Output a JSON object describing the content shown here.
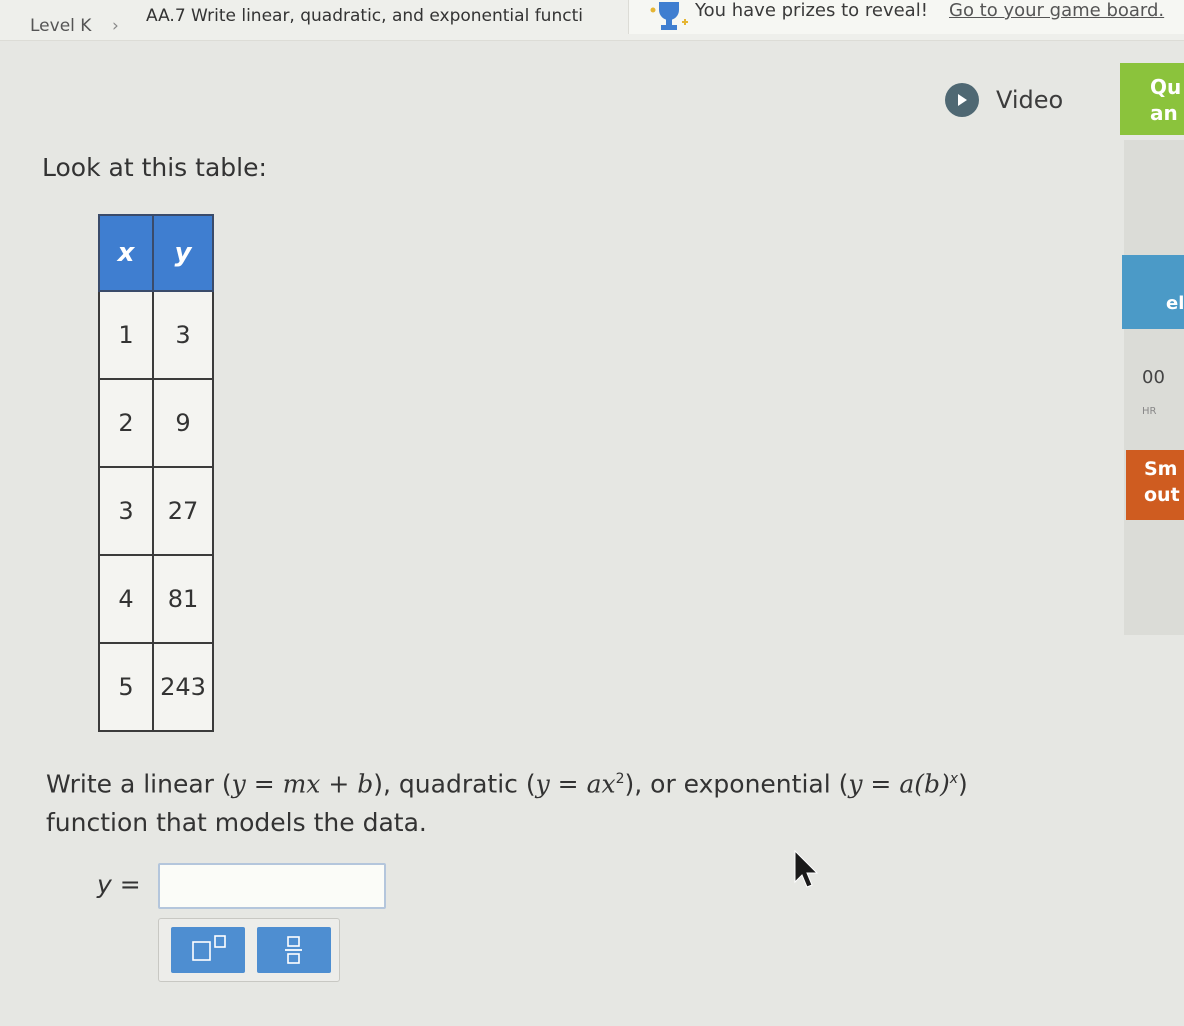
{
  "breadcrumb": {
    "level": "Level K",
    "skill": "AA.7 Write linear, quadratic, and exponential functi"
  },
  "prize_banner": {
    "text": "You have prizes to reveal!",
    "link": "Go to your game board."
  },
  "video": {
    "label": "Video",
    "icon": "play-icon"
  },
  "side": {
    "green_line1": "Qu",
    "green_line2": "an",
    "blue_text": "el",
    "number": "00",
    "hr_label": "HR",
    "orange_line1": "Sm",
    "orange_line2": "out"
  },
  "question": {
    "intro": "Look at this table:",
    "table": {
      "headers": [
        "x",
        "y"
      ],
      "rows": [
        [
          "1",
          "3"
        ],
        [
          "2",
          "9"
        ],
        [
          "3",
          "27"
        ],
        [
          "4",
          "81"
        ],
        [
          "5",
          "243"
        ]
      ]
    },
    "prompt_start": "Write a linear (",
    "linear_eq": "y = mx + b",
    "prompt_mid1": "), quadratic (",
    "quad_eq": "y = ax",
    "quad_exp": "2",
    "prompt_mid2": "), or exponential (",
    "exp_eq": "y = a(b)",
    "exp_exp": "x",
    "prompt_end": ")",
    "prompt_line2": "function that models the data.",
    "answer_label": "y ="
  },
  "colors": {
    "header_blue": "#3f7ed0",
    "key_blue": "#4e8ed1",
    "green": "#8bc33c",
    "orange": "#cf5c20"
  }
}
